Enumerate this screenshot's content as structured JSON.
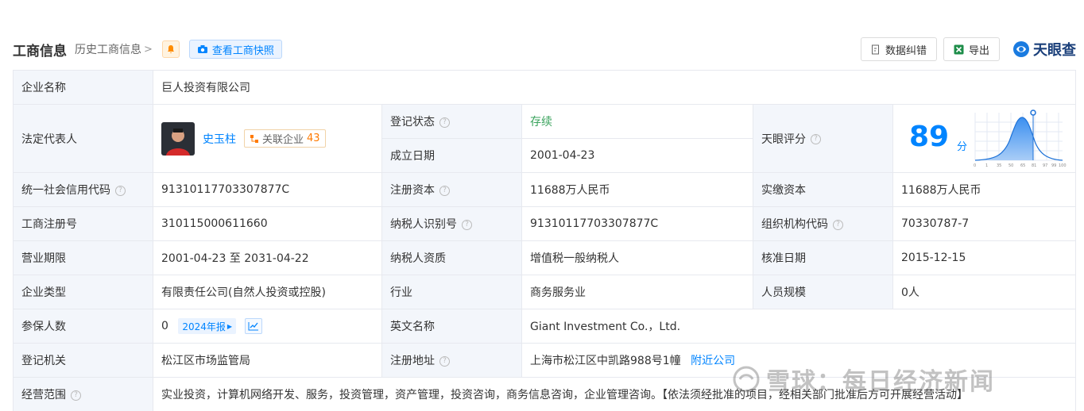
{
  "header": {
    "title": "工商信息",
    "history": "历史工商信息",
    "snapshot": "查看工商快照",
    "correction": "数据纠错",
    "export": "导出",
    "logo": "天眼查"
  },
  "rows": {
    "company_name": {
      "label": "企业名称",
      "value": "巨人投资有限公司"
    },
    "legal_rep": {
      "label": "法定代表人",
      "name": "史玉柱",
      "related_label": "关联企业",
      "related_count": "43"
    },
    "reg_status": {
      "label": "登记状态",
      "value": "存续"
    },
    "est_date": {
      "label": "成立日期",
      "value": "2001-04-23"
    },
    "score": {
      "label": "天眼评分",
      "value": "89",
      "unit": "分",
      "ticks": [
        "0",
        "1",
        "35",
        "50",
        "65",
        "81",
        "97",
        "99",
        "100"
      ]
    },
    "credit_code": {
      "label": "统一社会信用代码",
      "value": "91310117703307877C"
    },
    "reg_capital": {
      "label": "注册资本",
      "value": "11688万人民币"
    },
    "paid_capital": {
      "label": "实缴资本",
      "value": "11688万人民币"
    },
    "reg_no": {
      "label": "工商注册号",
      "value": "310115000611660"
    },
    "taxpayer_id": {
      "label": "纳税人识别号",
      "value": "91310117703307877C"
    },
    "org_code": {
      "label": "组织机构代码",
      "value": "70330787-7"
    },
    "biz_term": {
      "label": "营业期限",
      "value": "2001-04-23 至 2031-04-22"
    },
    "taxpayer_qual": {
      "label": "纳税人资质",
      "value": "增值税一般纳税人"
    },
    "approval_date": {
      "label": "核准日期",
      "value": "2015-12-15"
    },
    "company_type": {
      "label": "企业类型",
      "value": "有限责任公司(自然人投资或控股)"
    },
    "industry": {
      "label": "行业",
      "value": "商务服务业"
    },
    "staff_size": {
      "label": "人员规模",
      "value": "0人"
    },
    "insured": {
      "label": "参保人数",
      "value": "0",
      "report": "2024年报"
    },
    "english_name": {
      "label": "英文名称",
      "value": "Giant Investment Co.，Ltd."
    },
    "reg_authority": {
      "label": "登记机关",
      "value": "松江区市场监管局"
    },
    "reg_address": {
      "label": "注册地址",
      "value": "上海市松江区中凯路988号1幢",
      "nearby": "附近公司"
    },
    "biz_scope": {
      "label": "经营范围",
      "value": "实业投资，计算机网络开发、服务，投资管理，资产管理，投资咨询，商务信息咨询，企业管理咨询。【依法须经批准的项目，经相关部门批准后方可开展经营活动】"
    }
  },
  "watermark": "雪球：每日经济新闻",
  "colors": {
    "accent": "#0084ff",
    "label_bg": "#f3f6fb",
    "status_green": "#3aa35d",
    "count_orange": "#ff7a00"
  }
}
